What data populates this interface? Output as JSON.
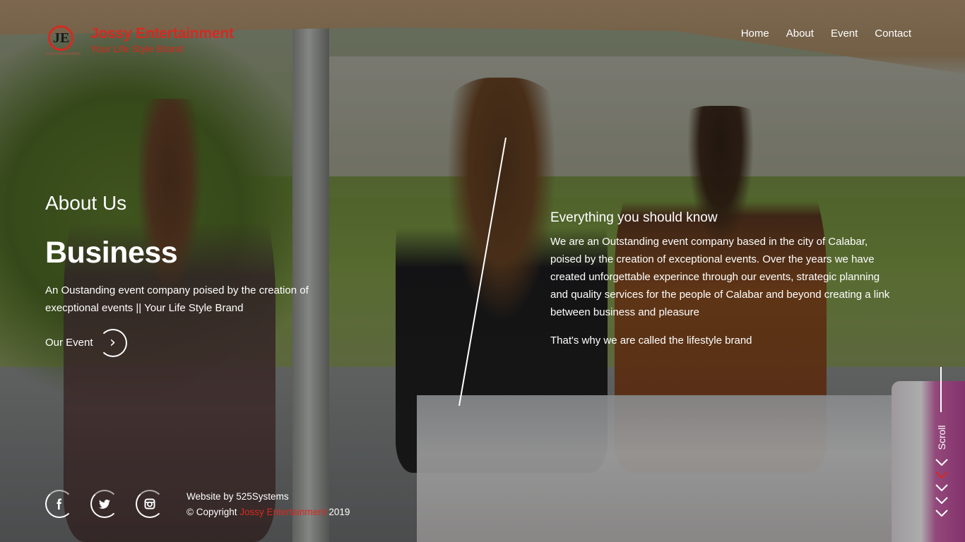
{
  "brand": {
    "name": "Jossy Entertainment",
    "tagline": "Your Life Style Brand",
    "accent_color": "#d8291f"
  },
  "nav": {
    "items": [
      {
        "label": "Home"
      },
      {
        "label": "About"
      },
      {
        "label": "Event"
      },
      {
        "label": "Contact"
      }
    ]
  },
  "hero": {
    "section_label": "About Us",
    "heading": "Business",
    "intro": "An Oustanding event company poised by the creation of execptional events || Your Life Style Brand",
    "cta_label": "Our Event",
    "cta_icon": "chevron-right-icon"
  },
  "about": {
    "subtitle": "Everything you should know",
    "body": "We are an Outstanding event company based in the city of Calabar, poised by the creation of exceptional events. Over the years we have created unforgettable experince through our events, strategic planning and quality services for the people of Calabar and beyond creating a link between business and pleasure",
    "closing": "That's why we are called the lifestyle brand"
  },
  "socials": [
    {
      "icon": "facebook-icon"
    },
    {
      "icon": "twitter-icon"
    },
    {
      "icon": "instagram-icon"
    }
  ],
  "footer": {
    "website_by": "Website by 525Systems",
    "copyright_prefix": "© Copyright",
    "copyright_name": "Jossy Entertainment",
    "copyright_year": "2019"
  },
  "scroll": {
    "label": "Scroll",
    "highlight_color": "#d8291f"
  }
}
